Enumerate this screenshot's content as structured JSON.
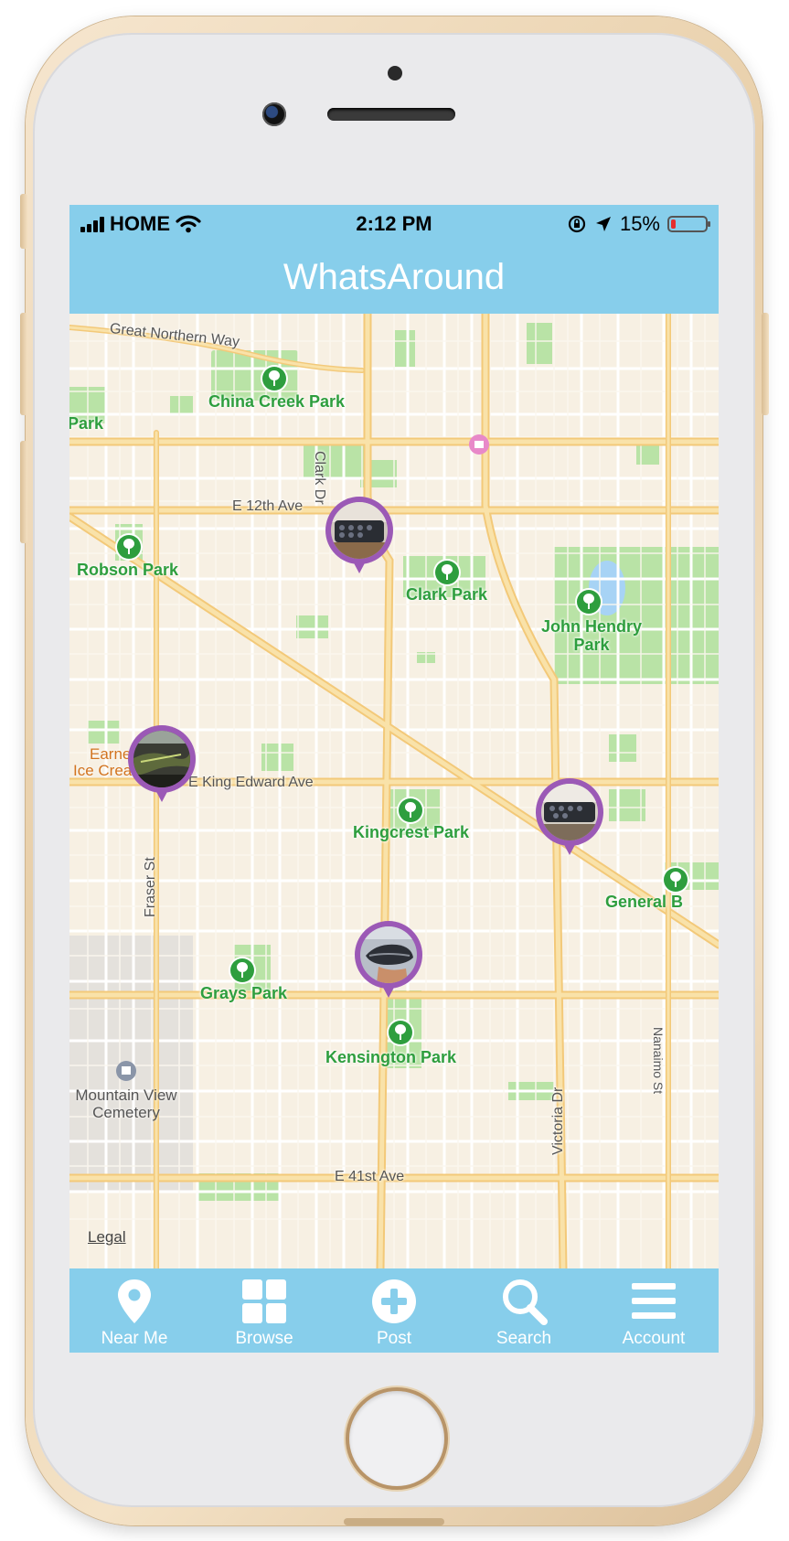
{
  "status_bar": {
    "carrier": "HOME",
    "time": "2:12 PM",
    "battery_percent": "15%",
    "battery_level": 0.15
  },
  "header": {
    "title": "WhatsAround"
  },
  "map": {
    "parks": [
      "China Creek Park",
      "Park",
      "Robson Park",
      "Clark Park",
      "John Hendry Park",
      "Kingcrest Park",
      "General B",
      "Grays Park",
      "Kensington Park"
    ],
    "streets": [
      "Great Northern Way",
      "Clark Dr",
      "E 12th Ave",
      "E King Edward Ave",
      "Fraser St",
      "Victoria Dr",
      "Nanaimo St",
      "E 41st Ave"
    ],
    "poi": {
      "cemetery": "Mountain View Cemetery",
      "earnest_top": "Earne",
      "earnest_bottom": "Ice Crea"
    },
    "legal": "Legal"
  },
  "pins": [
    {
      "name": "post-pin-clark",
      "photo": "tray-photo"
    },
    {
      "name": "post-pin-fraser",
      "photo": "aerial-photo"
    },
    {
      "name": "post-pin-victoria",
      "photo": "tray-photo"
    },
    {
      "name": "post-pin-kensington",
      "photo": "shoe-photo"
    }
  ],
  "tabs": [
    {
      "label": "Near Me",
      "icon": "map-pin-icon"
    },
    {
      "label": "Browse",
      "icon": "grid-icon"
    },
    {
      "label": "Post",
      "icon": "plus-circle-icon"
    },
    {
      "label": "Search",
      "icon": "search-icon"
    },
    {
      "label": "Account",
      "icon": "menu-icon"
    }
  ],
  "colors": {
    "accent": "#87ceeb",
    "pin": "#9b59b6",
    "park_text": "#2e9e3e",
    "road_major": "#f7d98a",
    "battery_low": "#e52e2e"
  }
}
